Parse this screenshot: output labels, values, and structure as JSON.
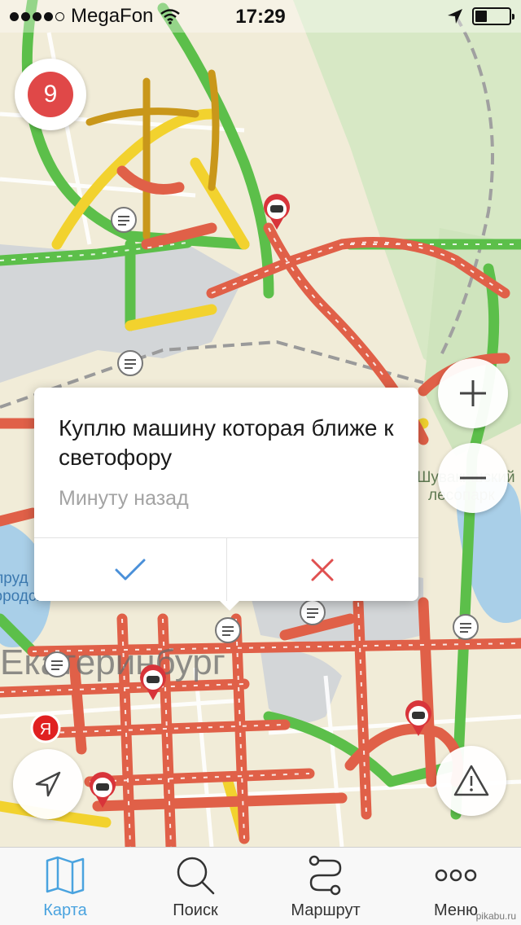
{
  "status_bar": {
    "carrier": "MegaFon",
    "time": "17:29",
    "signal_bars_filled": 4,
    "signal_bars_total": 5,
    "battery_level": 0.35
  },
  "traffic": {
    "score": "9",
    "color": "#e04848"
  },
  "map": {
    "labels": {
      "city": "Екатеринбург",
      "park_line1": "Шувакишский",
      "park_line2": "лесопарк",
      "pond_line1": "пруд",
      "pond_line2": "городской"
    },
    "yandex_logo": "Я"
  },
  "popup": {
    "message": "Куплю машину которая ближе к светофору",
    "timestamp": "Минуту назад",
    "confirm_icon": "checkmark-icon",
    "dismiss_icon": "close-icon",
    "confirm_color": "#4a90d9",
    "dismiss_color": "#e05050"
  },
  "controls": {
    "zoom_in_icon": "plus-icon",
    "zoom_out_icon": "minus-icon",
    "locate_icon": "location-arrow-icon",
    "report_icon": "warning-icon"
  },
  "tabbar": {
    "tabs": [
      {
        "label": "Карта",
        "icon": "map-icon",
        "active": true
      },
      {
        "label": "Поиск",
        "icon": "search-icon",
        "active": false
      },
      {
        "label": "Маршрут",
        "icon": "route-icon",
        "active": false
      },
      {
        "label": "Меню",
        "icon": "more-icon",
        "active": false
      }
    ],
    "active_color": "#4aa3df"
  },
  "watermark": "pikabu.ru"
}
